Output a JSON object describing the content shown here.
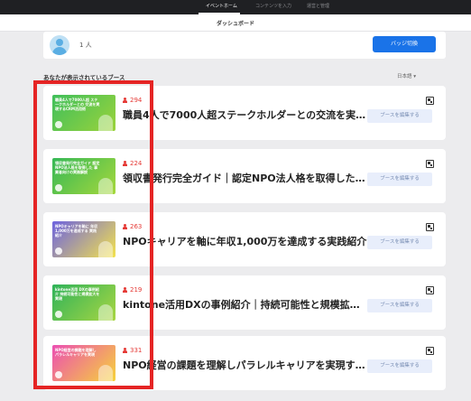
{
  "nav": {
    "tabs": [
      {
        "label": "イベントホーム",
        "active": true
      },
      {
        "label": "コンテンツを入力",
        "active": false
      },
      {
        "label": "運営と管理",
        "active": false
      }
    ]
  },
  "header": {
    "title": "ダッシュボード"
  },
  "user": {
    "count": "1 人",
    "switch_label": "バッジ切換"
  },
  "section": {
    "label": "あなたが表示されているブース",
    "language": "日本語 ▾"
  },
  "booths": [
    {
      "views": "294",
      "title": "職員4人で7000人超ステークホルダーとの交流を実現す...",
      "edit_label": "ブースを編集する",
      "thumb_text": "職員4人で7000人超 ステークホルダーとの 交流を実現するCRM活用術",
      "thumb_color": "#3fbf5b",
      "thumb_color2": "#9bd33b"
    },
    {
      "views": "224",
      "title": "領収書発行完全ガイド｜認定NPO法人格を取得した事...",
      "edit_label": "ブースを編集する",
      "thumb_text": "領収書発行完全ガイド 認定NPO法人格を取得した 事業者向けの実務解説",
      "thumb_color": "#35b856",
      "thumb_color2": "#a6d83c"
    },
    {
      "views": "263",
      "title": "NPOキャリアを軸に年収1,000万を達成する実践紹介",
      "edit_label": "ブースを編集する",
      "thumb_text": "NPOキャリアを軸に 年収1,000万を達成する 実践紹介",
      "thumb_color": "#6d63e0",
      "thumb_color2": "#f3e24c"
    },
    {
      "views": "219",
      "title": "kintone活用DXの事例紹介｜持続可能性と規模拡大を実...",
      "edit_label": "ブースを編集する",
      "thumb_text": "kintone活用 DXの事例紹介 持続可能性と規模拡大を実現",
      "thumb_color": "#2fb35a",
      "thumb_color2": "#a8d642"
    },
    {
      "views": "331",
      "title": "NPO経営の課題を理解しパラレルキャリアを実現する...",
      "edit_label": "ブースを編集する",
      "thumb_text": "NPO経営の課題を理解し パラレルキャリアを実現",
      "thumb_color": "#ec4fb2",
      "thumb_color2": "#f6d33a"
    }
  ]
}
